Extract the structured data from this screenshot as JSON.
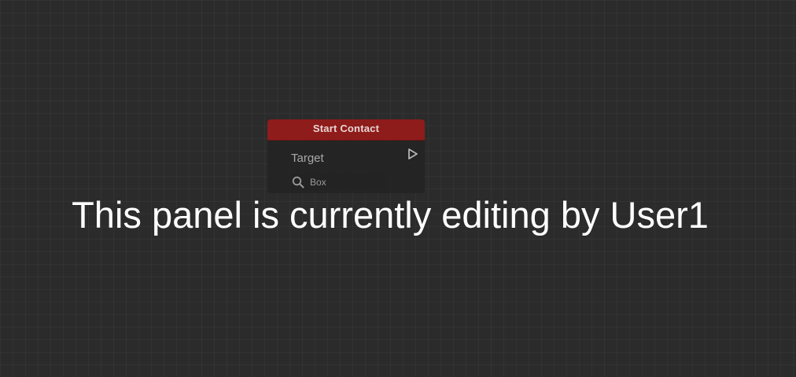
{
  "node": {
    "title": "Start Contact",
    "pin_label": "Target",
    "picker_value": "Box",
    "header_color": "#8e1c1a",
    "icons": {
      "exec_pin": "exec-output-pin-icon",
      "picker": "search-icon"
    }
  },
  "overlay": {
    "message": "This panel is currently editing by User1"
  }
}
